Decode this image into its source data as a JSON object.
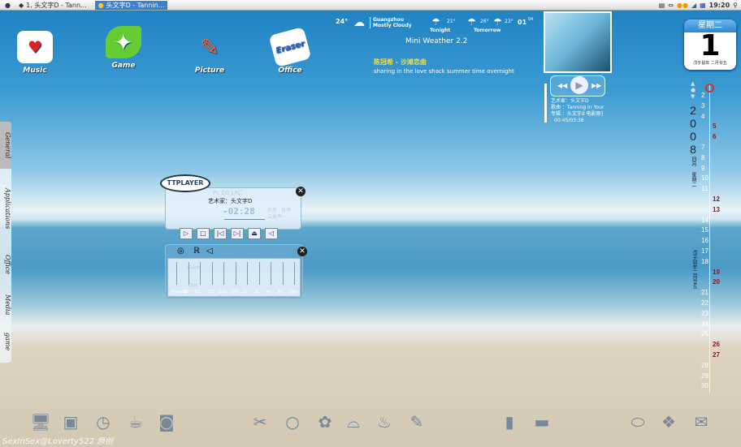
{
  "taskbar": {
    "tasks": [
      {
        "label": "1. 头文字D - Tann...",
        "active": false
      },
      {
        "label": "头文字D - Tannin...",
        "active": true
      }
    ],
    "clock": "19:20"
  },
  "desktop_icons": [
    {
      "label": "Music",
      "icon": "mug-icon"
    },
    {
      "label": "Game",
      "icon": "leaf-icon"
    },
    {
      "label": "Picture",
      "icon": "pencil-icon"
    },
    {
      "label": "Office",
      "icon": "eraser-icon"
    }
  ],
  "weather": {
    "now_temp": "24°",
    "city": "Guangzhou",
    "condition": "Mostly Cloudy",
    "tonight_label": "Tonight",
    "tonight_temp": "21°",
    "tomorrow_label": "Tomorrow",
    "tomorrow_high": "26°",
    "tomorrow_low": "23°",
    "date_day": "01",
    "date_month": "04",
    "title": "Mini Weather 2.2"
  },
  "lyrics": {
    "song": "陈冠希 - 沙滩恋曲",
    "line": "sharing in the love shack summer time overnight"
  },
  "mini_player": {
    "artist": "艺术家：头文字D",
    "song": "歌曲  ：Tanning In Your",
    "album": "专辑  ：头文字d 电影原]",
    "time": "00:45/03:38"
  },
  "calendar": {
    "weekday": "星期二",
    "day": "1",
    "lunar": "戊子鼠年 二月廿五",
    "year": "2008",
    "month": "四月",
    "weekday_v": "星期二",
    "lunar_v": "戊子鼠年二月廿五",
    "days": [
      "2",
      "3",
      "4",
      "5",
      "6",
      "7",
      "8",
      "9",
      "10",
      "11",
      "12",
      "13",
      "14",
      "15",
      "16",
      "17",
      "18",
      "19",
      "20",
      "21",
      "22",
      "23",
      "24",
      "25",
      "26",
      "27",
      "28",
      "29",
      "30"
    ],
    "weekend": [
      "5",
      "6",
      "12",
      "13",
      "19",
      "20",
      "26",
      "27"
    ]
  },
  "sidebar": [
    "General",
    "Applications",
    "Office",
    "Media",
    "game"
  ],
  "ttplayer": {
    "logo": "TTPLAYER",
    "tabs": "PL  EQ  LRC",
    "artist": "艺术家：头文字D",
    "time": "-02:28",
    "state_label": "状态",
    "state": "暂停",
    "mode": "立体声",
    "eq_labels": [
      "Preamp",
      "31",
      "62",
      "125",
      "250",
      "500",
      "1k",
      "2k",
      "4k",
      "8k",
      "16k"
    ],
    "eq_top": "+12db",
    "eq_bottom": "-12db"
  },
  "watermark": "SexInSex@Loverty522 原创"
}
